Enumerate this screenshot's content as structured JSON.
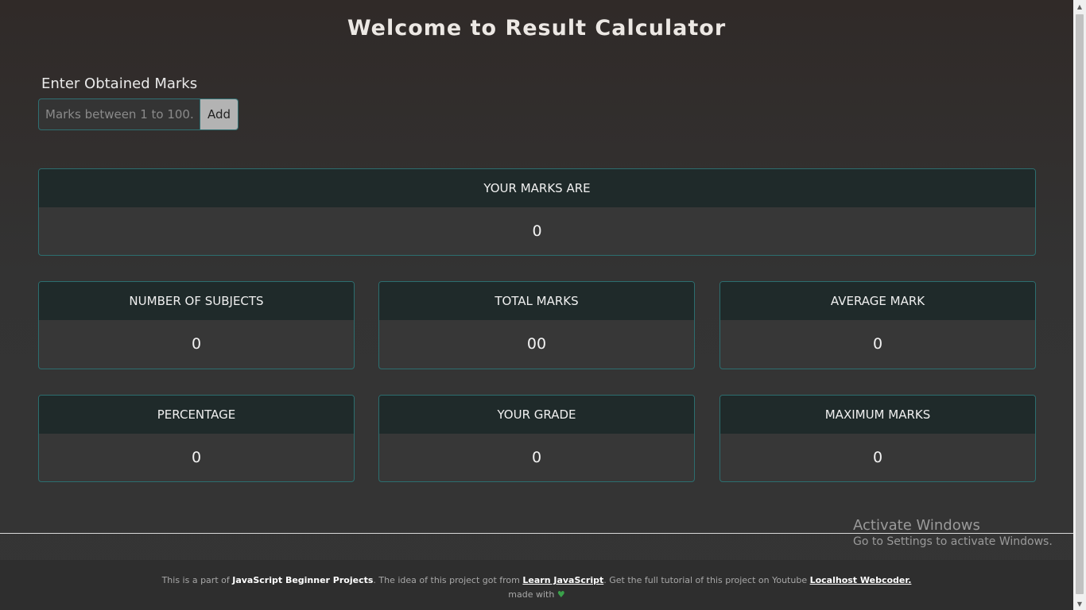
{
  "header": {
    "title": "Welcome to Result Calculator"
  },
  "input": {
    "label": "Enter Obtained Marks",
    "placeholder": "Marks between 1 to 100.",
    "value": "",
    "add_label": "Add"
  },
  "marks_card": {
    "title": "YOUR MARKS ARE",
    "value": "0"
  },
  "stats": {
    "subjects": {
      "title": "NUMBER OF SUBJECTS",
      "value": "0"
    },
    "total": {
      "title": "TOTAL MARKS",
      "value": "00"
    },
    "average": {
      "title": "AVERAGE MARK",
      "value": "0"
    },
    "percentage": {
      "title": "PERCENTAGE",
      "value": "0"
    },
    "grade": {
      "title": "YOUR GRADE",
      "value": "0"
    },
    "maximum": {
      "title": "MAXIMUM MARKS",
      "value": "0"
    }
  },
  "footer": {
    "prefix": "This is a part of",
    "project_series": "JavaScript Beginner Projects",
    "mid1": ". The idea of this project got from",
    "learn_link": "Learn JavaScript",
    "mid2": ". Get the full tutorial of this project on Youtube",
    "channel_link": "Localhost Webcoder.",
    "made_with": "made with",
    "heart_icon": "heart-icon"
  },
  "watermark": {
    "line1": "Activate Windows",
    "line2": "Go to Settings to activate Windows."
  },
  "colors": {
    "background": "#333333",
    "card_border": "#2c6e6f",
    "card_header": "#1f2a2a",
    "heart": "#3aa14a"
  }
}
